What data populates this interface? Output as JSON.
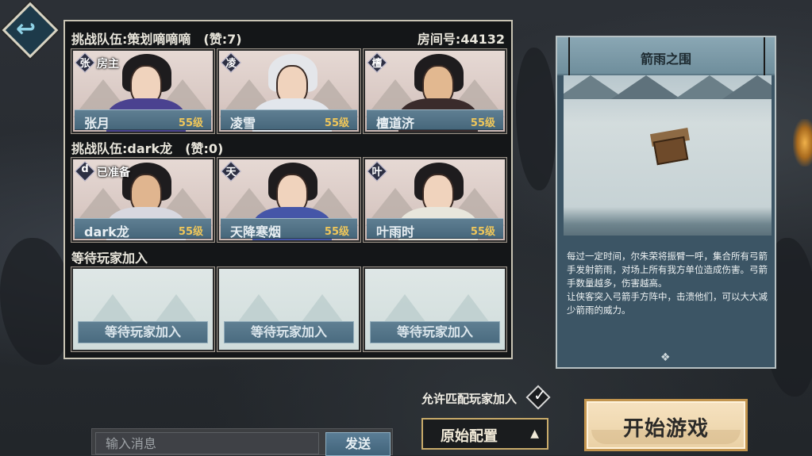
{
  "back_button": {
    "icon": "back-arrow-icon"
  },
  "team1": {
    "header": "挑战队伍:策划嘀嘀嘀　(赞:7)",
    "room": "房间号:44132",
    "members": [
      {
        "badge": "张",
        "tag": "房主",
        "name": "张月",
        "level": "55级"
      },
      {
        "badge": "凌",
        "tag": "",
        "name": "凌雪",
        "level": "55级"
      },
      {
        "badge": "檀",
        "tag": "",
        "name": "檀道济",
        "level": "55级"
      }
    ]
  },
  "team2": {
    "header": "挑战队伍:dark龙　(赞:0)",
    "members": [
      {
        "badge": "d",
        "tag": "已准备",
        "name": "dark龙",
        "level": "55级"
      },
      {
        "badge": "天",
        "tag": "",
        "name": "天降寒烟",
        "level": "55级"
      },
      {
        "badge": "叶",
        "tag": "",
        "name": "叶雨时",
        "level": "55级"
      }
    ]
  },
  "waiting": {
    "header": "等待玩家加入",
    "slots": [
      "等待玩家加入",
      "等待玩家加入",
      "等待玩家加入"
    ]
  },
  "map": {
    "title": "箭雨之围",
    "description_1": "每过一定时间，尔朱荣将振臂一呼，集合所有弓箭手发射箭雨，对场上所有我方单位造成伤害。弓箭手数量越多，伤害越高。",
    "description_2": "让侠客突入弓箭手方阵中，击溃他们，可以大大减少箭雨的威力。",
    "footer_icon": "diamond-ornament-icon"
  },
  "chat": {
    "placeholder": "输入消息",
    "send_label": "发送"
  },
  "match": {
    "label": "允许匹配玩家加入",
    "checked": true
  },
  "preset": {
    "label": "原始配置",
    "caret": "▲"
  },
  "start": {
    "label": "开始游戏"
  }
}
